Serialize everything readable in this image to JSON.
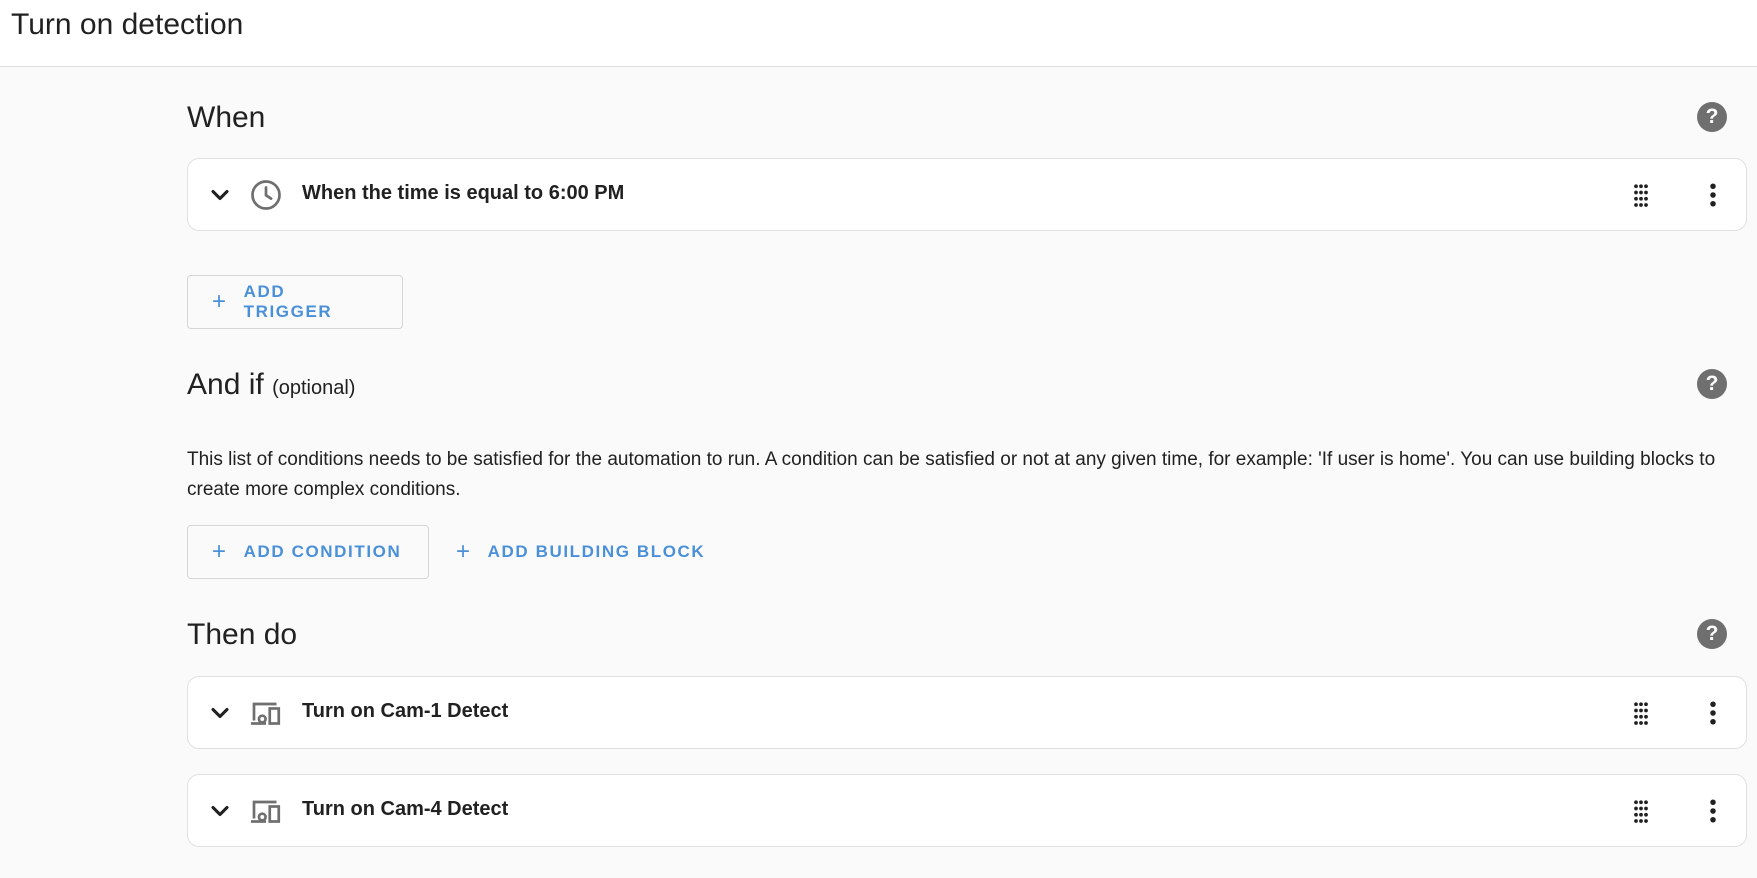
{
  "header": {
    "title": "Turn on detection"
  },
  "when": {
    "title": "When",
    "trigger_label": "When the time is equal to 6:00 PM",
    "add_trigger": "ADD TRIGGER"
  },
  "and_if": {
    "title": "And if",
    "optional": "(optional)",
    "description": "This list of conditions needs to be satisfied for the automation to run. A condition can be satisfied or not at any given time, for example: 'If user is home'. You can use building blocks to create more complex conditions.",
    "add_condition": "ADD CONDITION",
    "add_building_block": "ADD BUILDING BLOCK"
  },
  "then_do": {
    "title": "Then do",
    "actions": [
      {
        "label": "Turn on Cam-1 Detect",
        "icon": "device-icon"
      },
      {
        "label": "Turn on Cam-4 Detect",
        "icon": "device-icon"
      }
    ]
  },
  "icons": {
    "help": "help-icon",
    "expand": "chevron-down-icon",
    "clock": "clock-icon",
    "drag": "drag-handle-icon",
    "menu": "more-vert-icon"
  },
  "colors": {
    "accent": "#4a90d9",
    "help_icon_bg": "#6f6f6f",
    "card_border": "#e0e0e0",
    "background": "#fafafa"
  }
}
